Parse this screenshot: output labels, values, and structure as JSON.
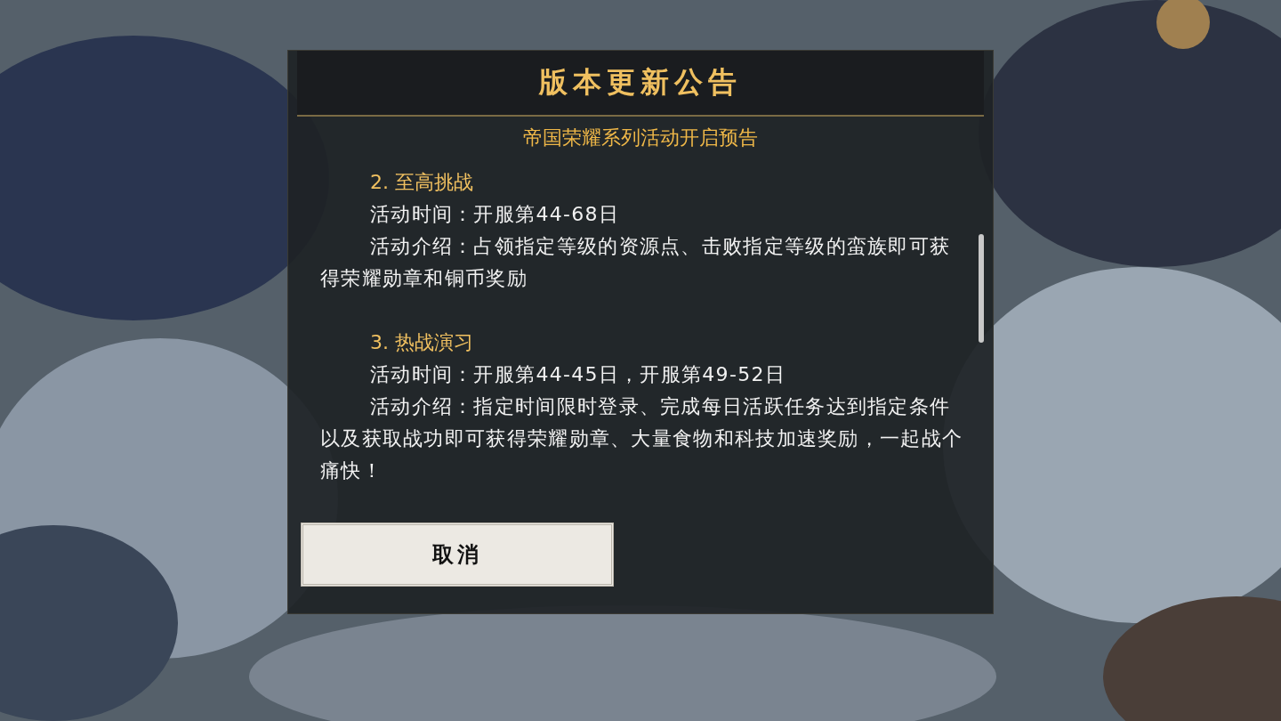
{
  "dialog": {
    "title": "版本更新公告",
    "subtitle": "帝国荣耀系列活动开启预告",
    "sections": [
      {
        "heading": "2. 至高挑战",
        "paragraphs": [
          "活动时间：开服第44-68日",
          "活动介绍：占领指定等级的资源点、击败指定等级的蛮族即可获得荣耀勋章和铜币奖励"
        ]
      },
      {
        "heading": "3. 热战演习",
        "paragraphs": [
          "活动时间：开服第44-45日，开服第49-52日",
          "活动介绍：指定时间限时登录、完成每日活跃任务达到指定条件以及获取战功即可获得荣耀勋章、大量食物和科技加速奖励，一起战个痛快！"
        ]
      }
    ],
    "buttons": [
      {
        "label": "取消"
      }
    ]
  }
}
